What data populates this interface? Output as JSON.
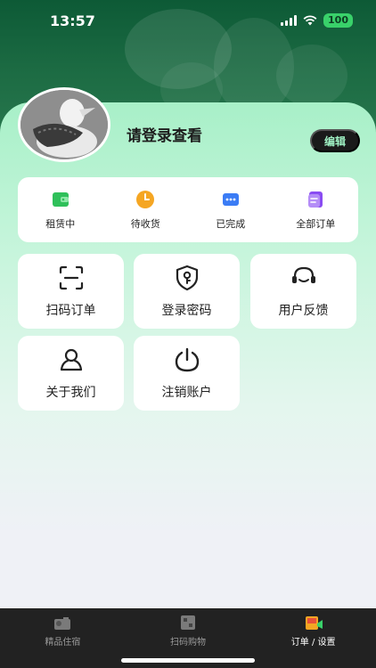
{
  "status_bar": {
    "time": "13:57",
    "battery": "100"
  },
  "profile": {
    "login_prompt": "请登录查看",
    "edit_label": "编辑"
  },
  "orders": [
    {
      "label": "租赁中",
      "icon": "wallet-icon",
      "color": "#2fc05a"
    },
    {
      "label": "待收货",
      "icon": "clock-icon",
      "color": "#f5a623"
    },
    {
      "label": "已完成",
      "icon": "chat-dots-icon",
      "color": "#3b7cf5"
    },
    {
      "label": "全部订单",
      "icon": "document-icon",
      "color": "#8a4cf2"
    }
  ],
  "tools": [
    {
      "label": "扫码订单",
      "icon": "scan-icon"
    },
    {
      "label": "登录密码",
      "icon": "shield-key-icon"
    },
    {
      "label": "用户反馈",
      "icon": "headset-icon"
    },
    {
      "label": "关于我们",
      "icon": "user-icon"
    },
    {
      "label": "注销账户",
      "icon": "power-icon"
    }
  ],
  "tabbar": [
    {
      "label": "精品住宿",
      "icon": "hotel-icon",
      "active": false
    },
    {
      "label": "扫码购物",
      "icon": "scan-cart-icon",
      "active": false
    },
    {
      "label": "订单 / 设置",
      "icon": "order-settings-icon",
      "active": true
    }
  ],
  "colors": {
    "accent": "#9ff0c3",
    "dark": "#1a1a1a",
    "hero": "#1c6b43"
  }
}
